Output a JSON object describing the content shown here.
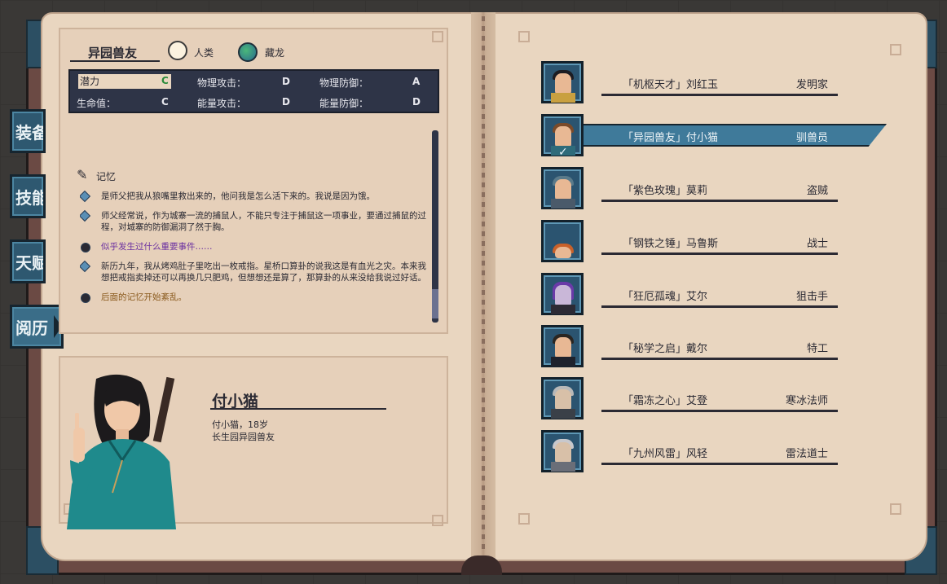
{
  "tabs": [
    {
      "label": "装备"
    },
    {
      "label": "技能"
    },
    {
      "label": "天赋"
    },
    {
      "label": "阅历",
      "active": true
    }
  ],
  "header": {
    "title": "异园兽友",
    "race": "人类",
    "origin": "藏龙"
  },
  "stats": {
    "potential_label": "潜力",
    "potential_grade": "C",
    "phys_atk_label": "物理攻击：",
    "phys_atk_grade": "D",
    "phys_def_label": "物理防御：",
    "phys_def_grade": "A",
    "hp_label": "生命值：",
    "hp_grade": "C",
    "energy_atk_label": "能量攻击：",
    "energy_atk_grade": "D",
    "energy_def_label": "能量防御：",
    "energy_def_grade": "D"
  },
  "memory": {
    "title": "记忆",
    "items": [
      {
        "text": "是师父把我从狼嘴里救出来的，他问我是怎么活下来的。我说是因为饿。",
        "type": "normal"
      },
      {
        "text": "师父经常说，作为城寨一流的捕鼠人，不能只专注于捕鼠这一项事业，要通过捕鼠的过程，对城寨的防御漏洞了然于胸。",
        "type": "normal"
      },
      {
        "text": "似乎发生过什么重要事件……",
        "type": "event"
      },
      {
        "text": "新历九年，我从烤鸡肚子里吃出一枚戒指。星桥口算卦的说我这是有血光之灾。本来我想把戒指卖掉还可以再换几只肥鸡，但想想还是算了，那算卦的从来没给我说过好话。",
        "type": "normal"
      },
      {
        "text": "后面的记忆开始紊乱。",
        "type": "chaos"
      }
    ]
  },
  "character": {
    "name": "付小猫",
    "line1": "付小猫，18岁",
    "line2": "长生园异园兽友"
  },
  "roster": [
    {
      "title": "「机枢天才」刘红玉",
      "job": "发明家"
    },
    {
      "title": "「异园兽友」付小猫",
      "job": "驯兽员",
      "selected": true
    },
    {
      "title": "「紫色玫瑰」莫莉",
      "job": "盗贼"
    },
    {
      "title": "「钢铁之锤」马鲁斯",
      "job": "战士"
    },
    {
      "title": "「狂厄孤魂」艾尔",
      "job": "狙击手"
    },
    {
      "title": "「秘学之启」戴尔",
      "job": "特工"
    },
    {
      "title": "「霜冻之心」艾登",
      "job": "寒冰法师"
    },
    {
      "title": "「九州风雷」风轻",
      "job": "雷法道士"
    }
  ],
  "colors": {
    "page": "#e9d6c0",
    "accent": "#3f7a9a",
    "dark": "#2e3447",
    "event": "#6a2fa0",
    "chaos": "#8a5a1d"
  }
}
